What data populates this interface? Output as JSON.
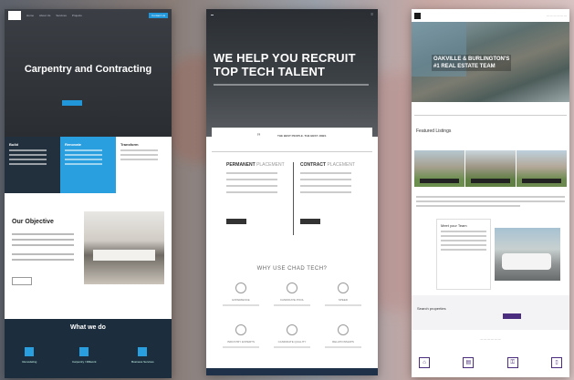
{
  "panel_construction": {
    "hero_title": "Carpentry and Contracting",
    "nav_items": [
      "Home",
      "About Us",
      "Services",
      "Projects",
      "Contact Us"
    ],
    "features": [
      {
        "heading": "Build",
        "color": "#22303d"
      },
      {
        "heading": "Renovate",
        "color": "#2a9fe0"
      },
      {
        "heading": "Transform",
        "color": "#ffffff"
      }
    ],
    "objective_heading": "Our Objective",
    "services_heading": "What we do",
    "services": [
      "Remodeling",
      "Carpentry / Millwork",
      "Business Services"
    ],
    "accent_color": "#2196d8"
  },
  "panel_recruiting": {
    "hero_title": "WE HELP YOU RECRUIT TOP TECH TALENT",
    "band_quote": "”",
    "band_text": "THE BEST PEOPLE. THE BEST JOBS",
    "permanent": {
      "label": "PERMANENT",
      "suffix": "PLACEMENT"
    },
    "contract": {
      "label": "CONTRACT",
      "suffix": "PLACEMENT"
    },
    "why_heading": "WHY USE CHAD TECH?",
    "benefits": [
      "EXPERIENCE",
      "CANDIDATE POOL",
      "SPEED",
      "INDUSTRY EXPERTS",
      "CANDIDATE QUALITY",
      "RELATIONSHIPS"
    ]
  },
  "panel_realestate": {
    "hero_title_line1": "OAKVILLE & BURLINGTON'S",
    "hero_title_line2": "#1 REAL ESTATE TEAM",
    "section_heading": "Featured Listings",
    "card_heading": "Meet your Team",
    "band_heading": "Search properties",
    "accent_color": "#4b2d7f",
    "icons": [
      "home-icon",
      "chart-icon",
      "key-icon",
      "document-icon"
    ]
  }
}
